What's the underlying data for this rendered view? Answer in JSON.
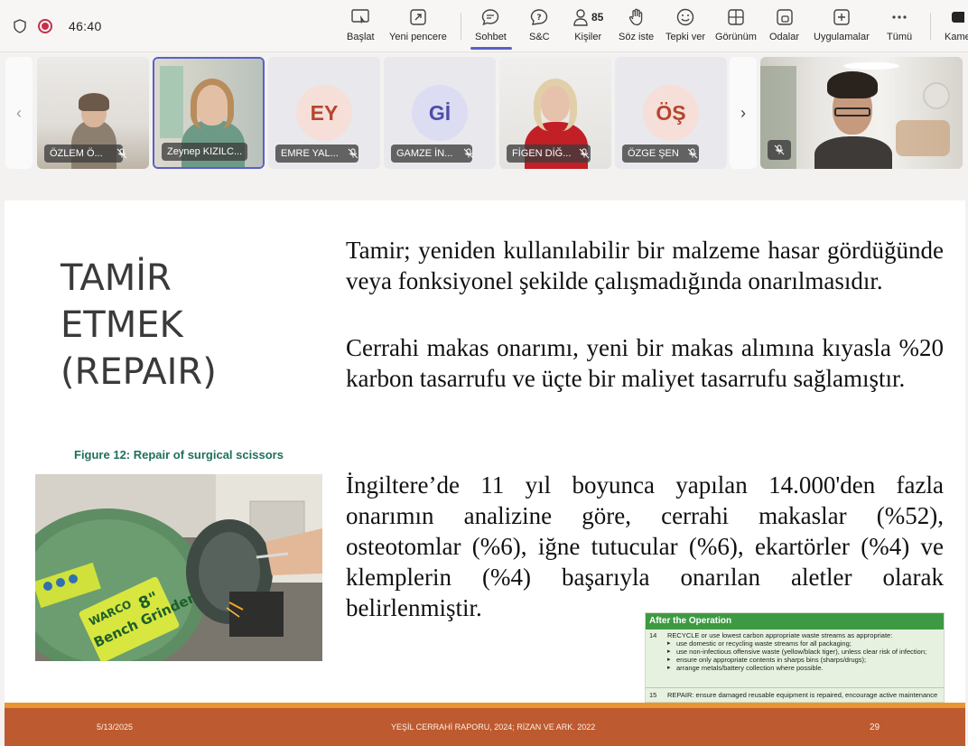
{
  "meeting": {
    "timer": "46:40"
  },
  "toolbar": {
    "items": [
      {
        "label": "Başlat"
      },
      {
        "label": "Yeni pencere"
      },
      {
        "label": "Sohbet"
      },
      {
        "label": "S&C"
      },
      {
        "label": "Kişiler",
        "count": "85"
      },
      {
        "label": "Söz iste"
      },
      {
        "label": "Tepki ver"
      },
      {
        "label": "Görünüm"
      },
      {
        "label": "Odalar"
      },
      {
        "label": "Uygulamalar"
      },
      {
        "label": "Tümü"
      },
      {
        "label": "Kame"
      }
    ],
    "accent_color": "#5b5fc7"
  },
  "participants": [
    {
      "name": "ÖZLEM Ö...",
      "initials": "",
      "video": true
    },
    {
      "name": "Zeynep KIZILC...",
      "initials": "",
      "video": true,
      "selected": true
    },
    {
      "name": "EMRE YAL...",
      "initials": "EY",
      "video": false,
      "avatar_bg": "#f6dfd8",
      "avatar_fg": "#b5452e"
    },
    {
      "name": "GAMZE İN...",
      "initials": "Gİ",
      "video": false,
      "avatar_bg": "#dcdcf3",
      "avatar_fg": "#4b4fa8"
    },
    {
      "name": "FİGEN DİĞ...",
      "initials": "",
      "video": true
    },
    {
      "name": "ÖZGE ŞEN",
      "initials": "ÖŞ",
      "video": false,
      "avatar_bg": "#f6dfd8",
      "avatar_fg": "#b5452e"
    }
  ],
  "slide": {
    "title_lines": [
      "TAMİR",
      "ETMEK",
      "(REPAIR)"
    ],
    "paragraphs": [
      "Tamir; yeniden kullanılabilir bir malzeme hasar gördüğünde veya fonksiyonel şekilde çalışmadığında onarılmasıdır.",
      "Cerrahi makas onarımı, yeni bir makas alımına kıyasla %20 karbon tasarrufu ve üçte bir maliyet tasarrufu sağlamıştır.",
      "İngiltere’de 11 yıl boyunca yapılan 14.000'den fazla onarımın analizine göre, cerrahi makaslar (%52), osteotomlar (%6), iğne tutucular (%6), ekartörler (%4) ve klemplerin (%4) başarıyla onarılan aletler olarak belirlenmiştir."
    ],
    "figure_caption": "Figure 12: Repair of surgical scissors",
    "figure_labels": {
      "brand": "WARCO",
      "product": "Bench Grinder",
      "size": "8\""
    },
    "table": {
      "header": "After the Operation",
      "row14_num": "14",
      "row14_text": "RECYCLE or use lowest carbon appropriate waste streams as appropriate:",
      "row14_bullets": [
        "use domestic or recycling waste streams for all packaging;",
        "use non-infectious offensive waste (yellow/black tiger), unless clear risk of infection;",
        "ensure only appropriate contents in sharps bins (sharps/drugs);",
        "arrange metals/battery collection where possible."
      ],
      "row15_num": "15",
      "row15_text": "REPAIR: ensure damaged reusable equipment is repaired, encourage active maintenance"
    },
    "footer": {
      "date": "5/13/2025",
      "source": "YEŞİL CERRAHİ RAPORU, 2024; RİZAN VE ARK. 2022",
      "page": "29"
    }
  }
}
